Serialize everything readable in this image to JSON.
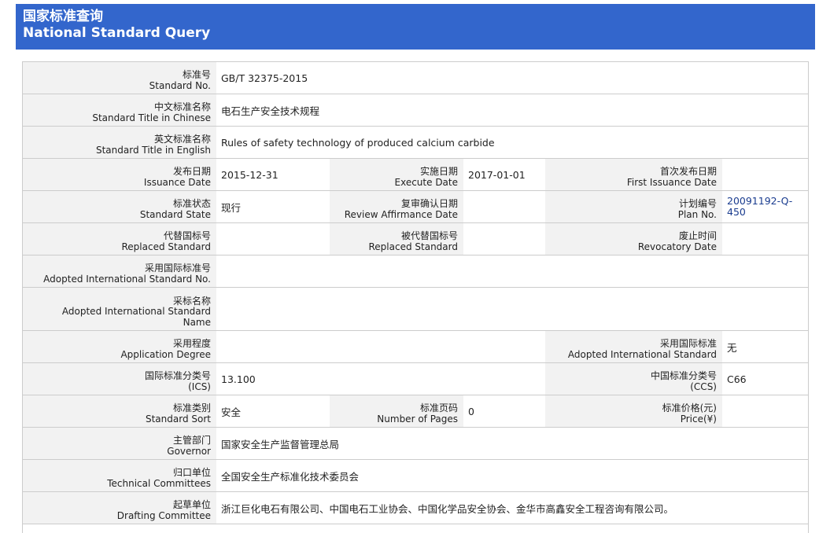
{
  "header": {
    "title_cn": "国家标准查询",
    "title_en": "National Standard Query"
  },
  "fields": {
    "standard_no": {
      "label_cn": "标准号",
      "label_en": "Standard No.",
      "value": "GB/T 32375-2015"
    },
    "title_cn": {
      "label_cn": "中文标准名称",
      "label_en": "Standard Title in Chinese",
      "value": "电石生产安全技术规程"
    },
    "title_en": {
      "label_cn": "英文标准名称",
      "label_en": "Standard Title in English",
      "value": "Rules of safety technology of produced calcium carbide"
    },
    "issuance_date": {
      "label_cn": "发布日期",
      "label_en": "Issuance Date",
      "value": "2015-12-31"
    },
    "execute_date": {
      "label_cn": "实施日期",
      "label_en": "Execute Date",
      "value": "2017-01-01"
    },
    "first_issuance_date": {
      "label_cn": "首次发布日期",
      "label_en": "First Issuance Date",
      "value": ""
    },
    "standard_state": {
      "label_cn": "标准状态",
      "label_en": "Standard State",
      "value": "现行"
    },
    "review_date": {
      "label_cn": "复审确认日期",
      "label_en": "Review Affirmance Date",
      "value": ""
    },
    "plan_no": {
      "label_cn": "计划编号",
      "label_en": "Plan No.",
      "value_line1": "20091192-Q-",
      "value_line2": "450"
    },
    "replaced_standard": {
      "label_cn": "代替国标号",
      "label_en": "Replaced Standard",
      "value": ""
    },
    "replaced_by": {
      "label_cn": "被代替国标号",
      "label_en": "Replaced Standard",
      "value": ""
    },
    "revocatory_date": {
      "label_cn": "废止时间",
      "label_en": "Revocatory Date",
      "value": ""
    },
    "adopted_intl_no": {
      "label_cn": "采用国际标准号",
      "label_en": "Adopted International Standard No.",
      "value": ""
    },
    "adopted_name": {
      "label_cn": "采标名称",
      "label_en_1": "Adopted International Standard",
      "label_en_2": "Name",
      "value": ""
    },
    "application_degree": {
      "label_cn": "采用程度",
      "label_en": "Application Degree",
      "value": ""
    },
    "adopted_intl_std": {
      "label_cn": "采用国际标准",
      "label_en": "Adopted International Standard",
      "value": "无"
    },
    "ics": {
      "label_cn": "国际标准分类号",
      "label_en": "(ICS)",
      "value": "13.100"
    },
    "ccs": {
      "label_cn": "中国标准分类号",
      "label_en": "(CCS)",
      "value": "C66"
    },
    "standard_sort": {
      "label_cn": "标准类别",
      "label_en": "Standard Sort",
      "value": "安全"
    },
    "pages": {
      "label_cn": "标准页码",
      "label_en": "Number of Pages",
      "value": "0"
    },
    "price": {
      "label_cn": "标准价格(元)",
      "label_en": "Price(¥)",
      "value": ""
    },
    "governor": {
      "label_cn": "主管部门",
      "label_en": "Governor",
      "value": "国家安全生产监督管理总局"
    },
    "technical_committees": {
      "label_cn": "归口单位",
      "label_en": "Technical Committees",
      "value": "全国安全生产标准化技术委员会"
    },
    "drafting_committee": {
      "label_cn": "起草单位",
      "label_en": "Drafting Committee",
      "value": "浙江巨化电石有限公司、中国电石工业协会、中国化学品安全协会、金华市高鑫安全工程咨询有限公司。"
    }
  }
}
